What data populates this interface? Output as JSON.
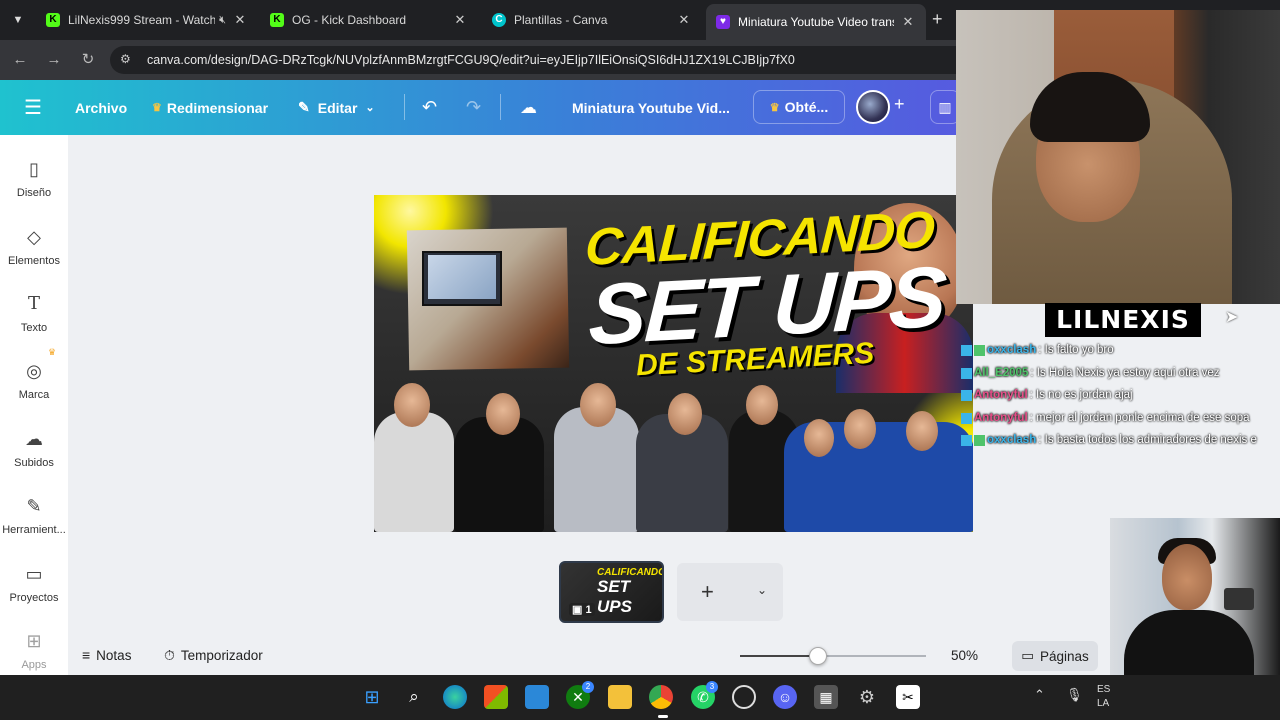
{
  "browser": {
    "tabs": [
      {
        "title": "LilNexis999 Stream - Watch",
        "icon": "kick-icon",
        "color": "#53fc18",
        "active": false
      },
      {
        "title": "OG - Kick Dashboard",
        "icon": "kick-icon",
        "color": "#53fc18",
        "active": false
      },
      {
        "title": "Plantillas - Canva",
        "icon": "canva-icon",
        "color": "#00c4cc",
        "active": false
      },
      {
        "title": "Miniatura Youtube Video transm",
        "icon": "canva-heart-icon",
        "color": "#7d2ae8",
        "active": true
      }
    ],
    "url": "canva.com/design/DAG-DRzTcgk/NUVplzfAnmBMzrgtFCGU9Q/edit?ui=eyJEIjp7IlEiOnsiQSI6dHJ1ZX19LCJBIjp7fX0"
  },
  "canva": {
    "header": {
      "file": "Archivo",
      "resize": "Redimensionar",
      "edit": "Editar",
      "doc_title": "Miniatura Youtube Vid...",
      "upgrade": "Obté...",
      "add": "+"
    },
    "sidebar": [
      {
        "label": "Diseño",
        "icon": "design-icon",
        "glyph": "▯"
      },
      {
        "label": "Elementos",
        "icon": "elements-icon",
        "glyph": "◇"
      },
      {
        "label": "Texto",
        "icon": "text-icon",
        "glyph": "T"
      },
      {
        "label": "Marca",
        "icon": "brand-icon",
        "glyph": "◎"
      },
      {
        "label": "Subidos",
        "icon": "upload-icon",
        "glyph": "☁"
      },
      {
        "label": "Herramient...",
        "icon": "tools-icon",
        "glyph": "✎"
      },
      {
        "label": "Proyectos",
        "icon": "folder-icon",
        "glyph": "▭"
      },
      {
        "label": "Apps",
        "icon": "apps-icon",
        "glyph": "⊞"
      }
    ],
    "design": {
      "line1": "CALIFICANDO",
      "line2": "SET UPS",
      "line3": "DE STREAMERS",
      "accent": "#f5e400"
    },
    "pages": {
      "thumb_t1": "CALIFICANDO",
      "thumb_t2": "SET UPS",
      "page_number": "1",
      "add_label": "+"
    },
    "bottom": {
      "notes": "Notas",
      "timer": "Temporizador",
      "zoom": "50%",
      "zoom_level": 0.42,
      "pages": "Páginas"
    }
  },
  "stream": {
    "name": "LILNEXIS",
    "chat": [
      {
        "user": "oxxclash",
        "user_color": "#3ab4e8",
        "badge": "blue",
        "msg": ": Is falto yo bro"
      },
      {
        "user": "All_E2005",
        "user_color": "#4fc36a",
        "badge": "green",
        "msg": ": Is Hola Nexis ya estoy aqui otra vez"
      },
      {
        "user": "Antonyful",
        "user_color": "#e8508a",
        "badge": "none",
        "msg": ": Is no es jordan ajaj"
      },
      {
        "user": "Antonyful",
        "user_color": "#e8508a",
        "badge": "none",
        "msg": ": mejor al jordan ponle encima de ese sopa"
      },
      {
        "user": "oxxclash",
        "user_color": "#3ab4e8",
        "badge": "blue",
        "msg": ": Is basta todos los admiradores de nexis e"
      }
    ]
  },
  "taskbar": {
    "apps": [
      "windows-start-icon",
      "search-icon",
      "edge-icon",
      "store-icon",
      "stack-icon",
      "xbox-icon",
      "folder-icon",
      "chrome-icon",
      "whatsapp-icon",
      "nodes-icon",
      "discord-icon",
      "capture-icon",
      "settings-icon",
      "capcut-icon"
    ],
    "xbox_badge": "2",
    "whatsapp_badge": "3",
    "tray_text_1": "ES",
    "tray_text_2": "LA"
  }
}
